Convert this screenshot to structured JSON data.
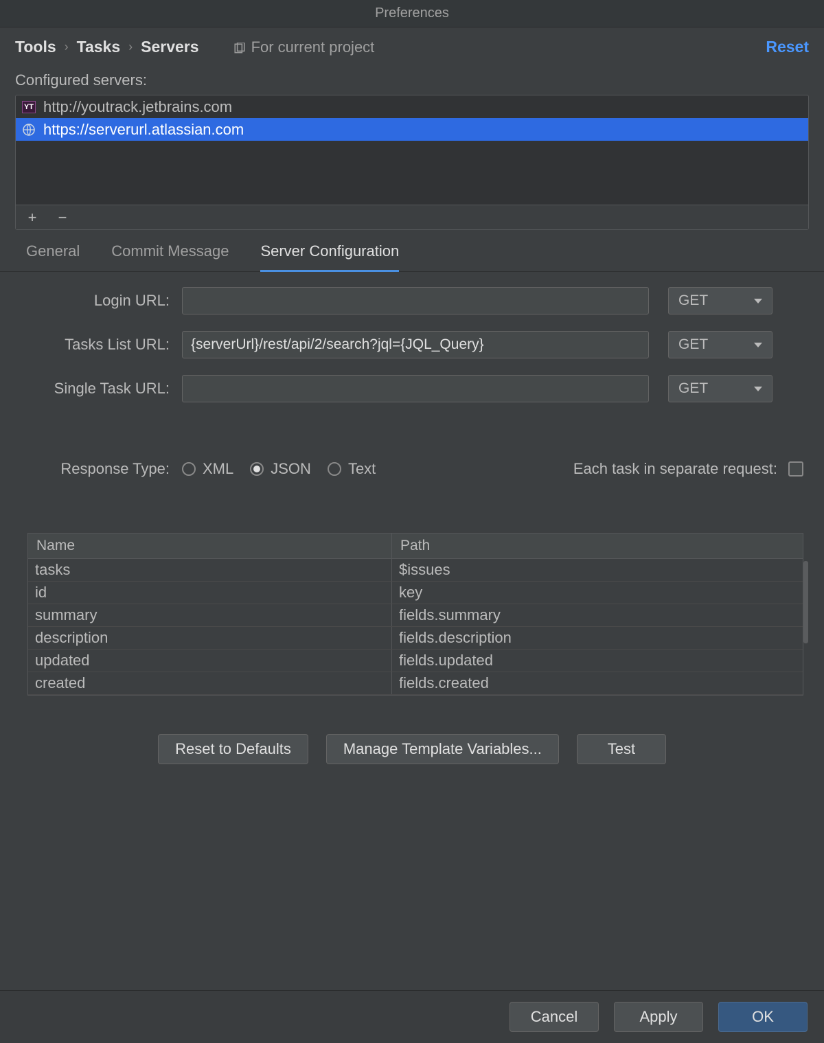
{
  "title": "Preferences",
  "breadcrumb": [
    "Tools",
    "Tasks",
    "Servers"
  ],
  "for_project_label": "For current project",
  "reset_label": "Reset",
  "configured_servers_label": "Configured servers:",
  "servers": [
    {
      "icon": "youtrack-icon",
      "url": "http://youtrack.jetbrains.com",
      "selected": false
    },
    {
      "icon": "globe-icon",
      "url": "https://serverurl.atlassian.com",
      "selected": true
    }
  ],
  "toolbar": {
    "add": "+",
    "remove": "−"
  },
  "tabs": [
    {
      "id": "general",
      "label": "General",
      "active": false
    },
    {
      "id": "commit",
      "label": "Commit Message",
      "active": false
    },
    {
      "id": "server",
      "label": "Server Configuration",
      "active": true
    }
  ],
  "form": {
    "login_url": {
      "label": "Login URL:",
      "value": "",
      "method": "GET"
    },
    "tasks_list_url": {
      "label": "Tasks List URL:",
      "value": "{serverUrl}/rest/api/2/search?jql={JQL_Query}",
      "method": "GET"
    },
    "single_task_url": {
      "label": "Single Task URL:",
      "value": "",
      "method": "GET"
    }
  },
  "response_type": {
    "label": "Response Type:",
    "options": [
      "XML",
      "JSON",
      "Text"
    ],
    "selected": "JSON"
  },
  "each_task_label": "Each task in separate request:",
  "each_task_checked": false,
  "table": {
    "columns": [
      "Name",
      "Path"
    ],
    "rows": [
      {
        "name": "tasks",
        "path": "$issues"
      },
      {
        "name": "id",
        "path": "key"
      },
      {
        "name": "summary",
        "path": "fields.summary"
      },
      {
        "name": "description",
        "path": "fields.description"
      },
      {
        "name": "updated",
        "path": "fields.updated"
      },
      {
        "name": "created",
        "path": "fields.created"
      }
    ]
  },
  "panel_buttons": {
    "reset_defaults": "Reset to Defaults",
    "manage_vars": "Manage Template Variables...",
    "test": "Test"
  },
  "dialog_buttons": {
    "cancel": "Cancel",
    "apply": "Apply",
    "ok": "OK"
  }
}
